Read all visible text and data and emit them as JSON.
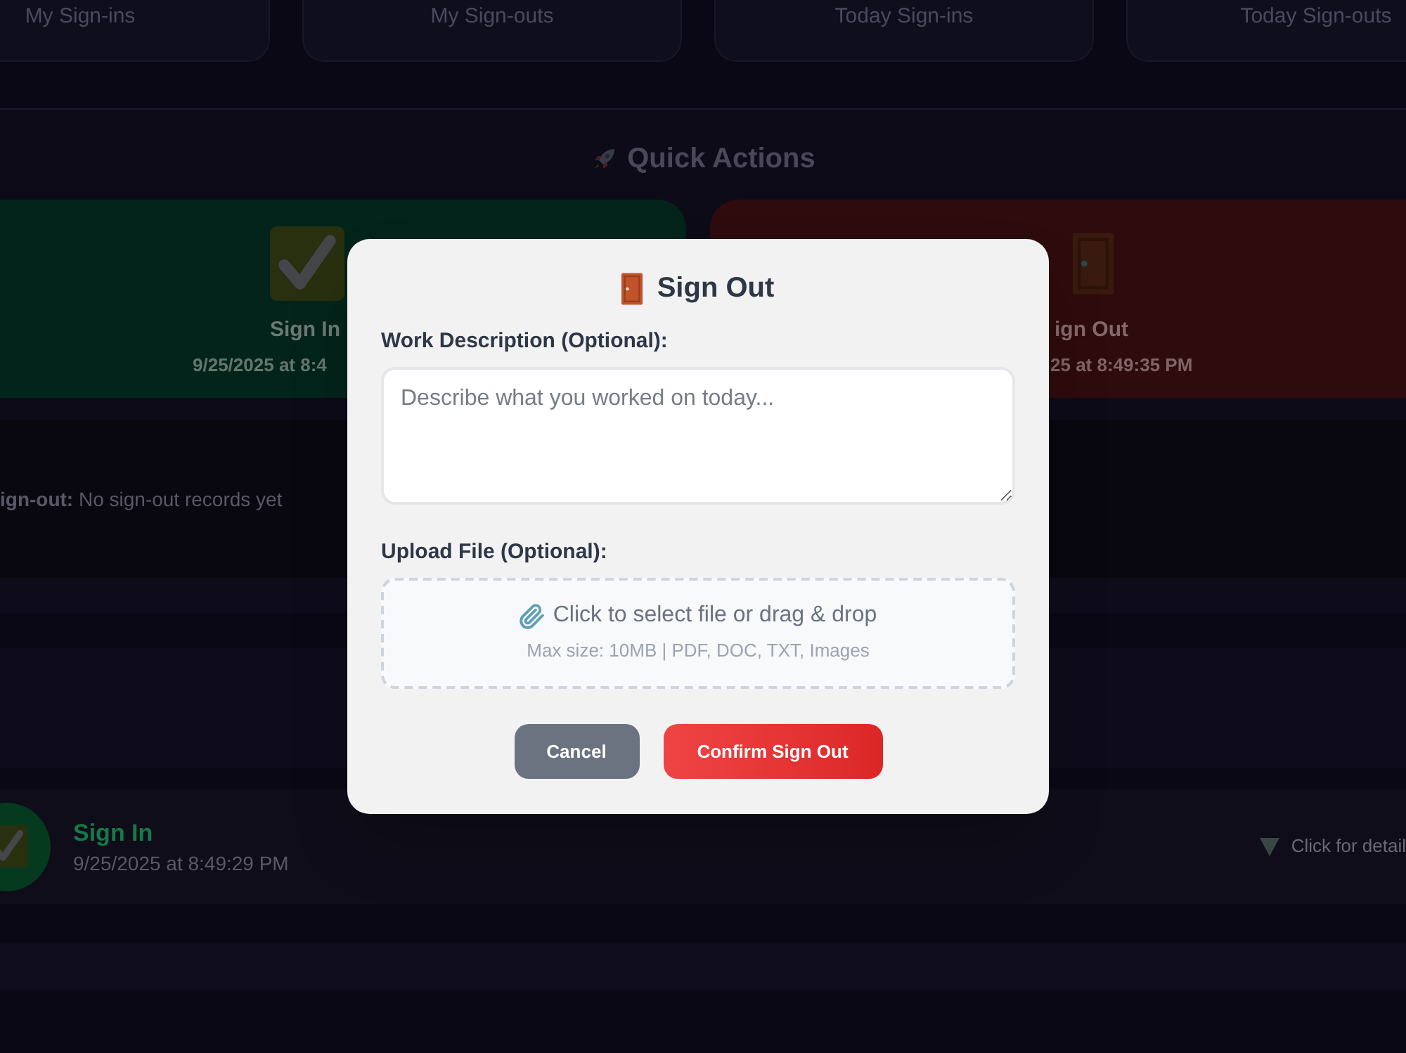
{
  "stats": [
    {
      "label": "My Sign-ins"
    },
    {
      "label": "My Sign-outs"
    },
    {
      "label": "Today Sign-ins"
    },
    {
      "label": "Today Sign-outs"
    }
  ],
  "quick_actions": {
    "title": "Quick Actions",
    "actions": [
      {
        "kind": "sign_in",
        "label": "Sign In",
        "time": "9/25/2025 at 8:4"
      },
      {
        "kind": "sign_out",
        "label": "ign Out",
        "time": "25 at 8:49:35 PM"
      }
    ]
  },
  "status": {
    "text": "**ign-out:** No sign-out records yet"
  },
  "records": [
    {
      "kind": "sign_in",
      "label": "Sign In",
      "time": "9/25/2025 at 8:49:29 PM",
      "hint": "Click for detail"
    }
  ],
  "modal": {
    "title": "Sign Out",
    "description": {
      "label": "Work Description (Optional):",
      "placeholder": "Describe what you worked on today..."
    },
    "upload": {
      "label": "Upload File (Optional):",
      "prompt": "Click to select file or drag & drop",
      "note": "Max size: 10MB | PDF, DOC, TXT, Images"
    },
    "buttons": [
      {
        "kind": "cancel",
        "label": "Cancel"
      },
      {
        "kind": "confirm",
        "label": "Confirm Sign Out"
      }
    ]
  }
}
